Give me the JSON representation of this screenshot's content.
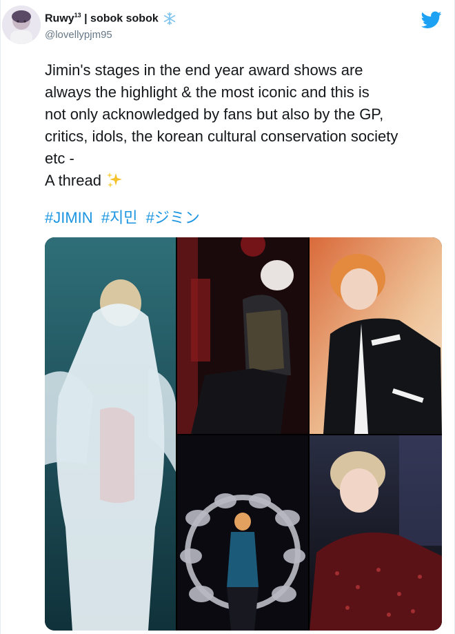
{
  "user": {
    "display_name": "Ruwy",
    "superscript": "13",
    "display_name_suffix": " | sobok sobok",
    "handle": "@lovellypjm95"
  },
  "tweet": {
    "lines": [
      "Jimin's stages in the end year award shows are",
      "always the highlight & the most iconic and this is",
      "not only acknowledged by fans but also by the GP,",
      "critics, idols, the korean cultural conservation society",
      "etc -",
      "A thread"
    ],
    "hashtags": [
      "#JIMIN",
      "#지민",
      "#ジミン"
    ]
  },
  "icons": {
    "header_badge": "snowflake-icon",
    "brand": "twitter-bird-icon",
    "emoji": "sparkles-icon"
  },
  "colors": {
    "link": "#1b95e0",
    "brand": "#1da1f2",
    "text": "#14171a",
    "secondary": "#657786"
  }
}
